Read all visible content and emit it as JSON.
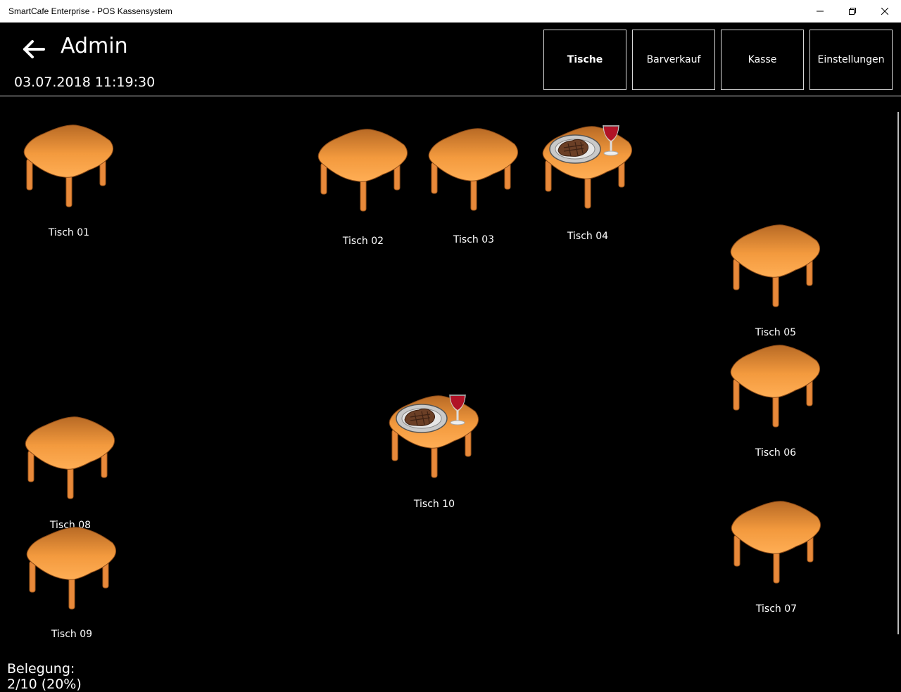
{
  "window": {
    "title": "SmartCafe Enterprise - POS Kassensystem"
  },
  "header": {
    "title": "Admin",
    "datetime": "03.07.2018 11:19:30",
    "back_icon": "arrow-left-icon"
  },
  "nav": [
    {
      "label": "Tische",
      "active": true
    },
    {
      "label": "Barverkauf",
      "active": false
    },
    {
      "label": "Kasse",
      "active": false
    },
    {
      "label": "Einstellungen",
      "active": false
    }
  ],
  "tables": [
    {
      "label": "Tisch 01",
      "occupied": false
    },
    {
      "label": "Tisch 02",
      "occupied": false
    },
    {
      "label": "Tisch 03",
      "occupied": false
    },
    {
      "label": "Tisch 04",
      "occupied": true
    },
    {
      "label": "Tisch 05",
      "occupied": false
    },
    {
      "label": "Tisch 06",
      "occupied": false
    },
    {
      "label": "Tisch 07",
      "occupied": false
    },
    {
      "label": "Tisch 08",
      "occupied": false
    },
    {
      "label": "Tisch 09",
      "occupied": false
    },
    {
      "label": "Tisch 10",
      "occupied": true
    }
  ],
  "footer": {
    "occupancy_label": "Belegung:",
    "occupancy_value": "2/10 (20%)"
  },
  "colors": {
    "table_top": "#f39a3e",
    "table_leg": "#e8893a",
    "background": "#000000"
  }
}
